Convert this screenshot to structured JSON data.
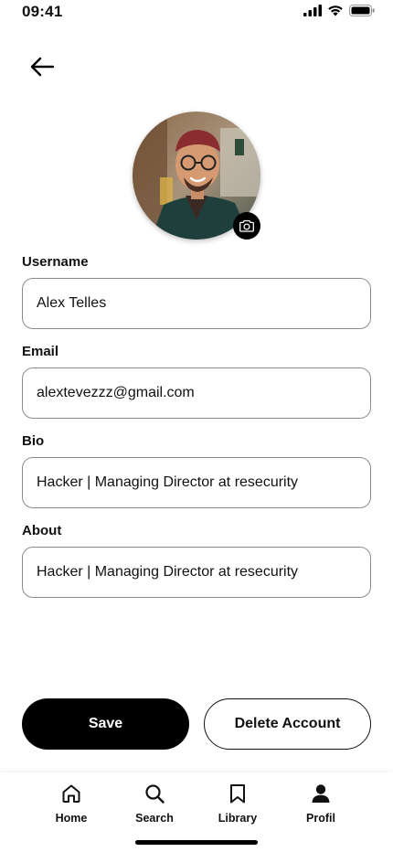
{
  "status_bar": {
    "time": "09:41"
  },
  "profile": {
    "avatar_alt": "Profile photo"
  },
  "form": {
    "username": {
      "label": "Username",
      "value": "Alex Telles",
      "placeholder": ""
    },
    "email": {
      "label": "Email",
      "value": "alextevezzz@gmail.com",
      "placeholder": ""
    },
    "bio": {
      "label": "Bio",
      "value": "Hacker | Managing Director at resecurity",
      "placeholder": ""
    },
    "about": {
      "label": "About",
      "value": "Hacker | Managing Director at resecurity",
      "placeholder": ""
    }
  },
  "actions": {
    "save_label": "Save",
    "delete_label": "Delete Account"
  },
  "nav": {
    "items": [
      {
        "label": "Home",
        "icon": "home-icon"
      },
      {
        "label": "Search",
        "icon": "search-icon"
      },
      {
        "label": "Library",
        "icon": "bookmark-icon"
      },
      {
        "label": "Profil",
        "icon": "user-icon"
      }
    ]
  },
  "colors": {
    "primary": "#000000",
    "background": "#ffffff",
    "border": "#8c8c8c"
  }
}
